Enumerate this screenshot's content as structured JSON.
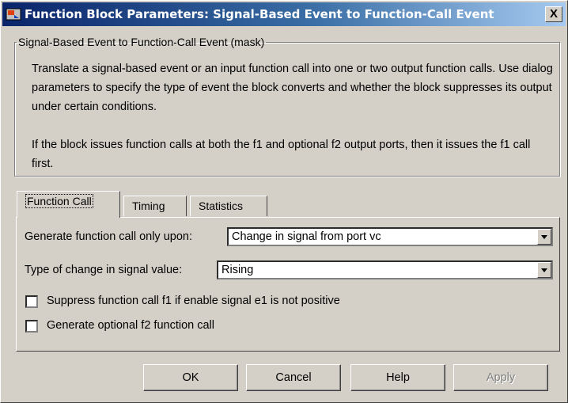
{
  "window": {
    "title": "Function Block Parameters: Signal-Based Event to Function-Call Event",
    "close_glyph": "X",
    "icon": "simulink-block-icon"
  },
  "mask": {
    "legend": "Signal-Based Event to Function-Call Event (mask)",
    "description": [
      "Translate a signal-based event or an input function call into one or two output function calls. Use dialog parameters to specify the type of event the block converts and whether the block suppresses its output under certain conditions.",
      "If the block issues function calls at both the f1 and optional f2 output ports, then it issues the f1 call first."
    ]
  },
  "tabs": [
    {
      "label": "Function Call",
      "active": true
    },
    {
      "label": "Timing",
      "active": false
    },
    {
      "label": "Statistics",
      "active": false
    }
  ],
  "params": {
    "generate_label": "Generate function call only upon:",
    "generate_value": "Change in signal from port vc",
    "change_label": "Type of change in signal value:",
    "change_value": "Rising",
    "suppress_label": "Suppress function call f1 if enable signal e1 is not positive",
    "suppress_checked": false,
    "optional_label": "Generate optional f2 function call",
    "optional_checked": false
  },
  "buttons": {
    "ok": "OK",
    "cancel": "Cancel",
    "help": "Help",
    "apply": "Apply"
  },
  "colors": {
    "title_start": "#0a246a",
    "title_end": "#a6caf0",
    "face": "#d4d0c8"
  }
}
